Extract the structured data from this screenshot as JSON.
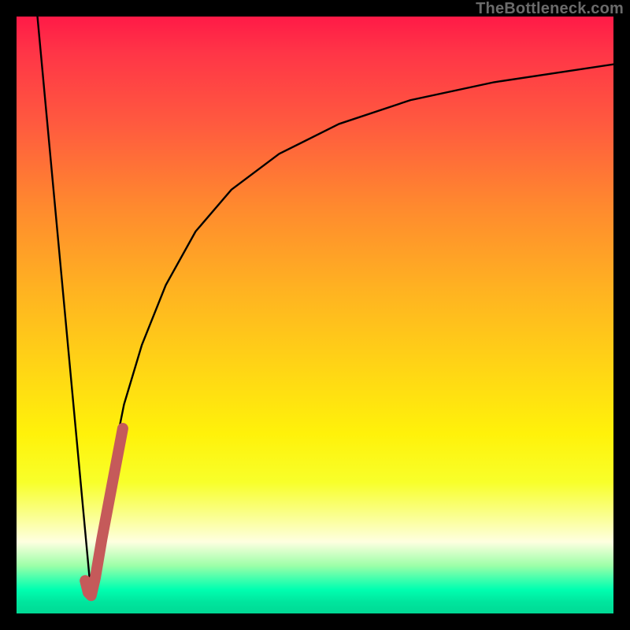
{
  "watermark": {
    "text": "TheBottleneck.com"
  },
  "colors": {
    "frame": "#000000",
    "curve_black": "#000000",
    "highlight_stroke": "#c55a5a"
  },
  "chart_data": {
    "type": "line",
    "title": "",
    "xlabel": "",
    "ylabel": "",
    "xlim": [
      0,
      100
    ],
    "ylim": [
      0,
      100
    ],
    "grid": false,
    "legend": false,
    "series": [
      {
        "name": "left-descending",
        "x": [
          3.5,
          12.5
        ],
        "y": [
          100,
          3
        ]
      },
      {
        "name": "right-rising",
        "x": [
          12.5,
          14,
          16,
          18,
          21,
          25,
          30,
          36,
          44,
          54,
          66,
          80,
          100
        ],
        "y": [
          3,
          14,
          25,
          35,
          45,
          55,
          64,
          71,
          77,
          82,
          86,
          89,
          92
        ]
      },
      {
        "name": "highlight-j",
        "x": [
          11.5,
          12.0,
          12.5,
          13.2,
          14.3,
          15.9,
          17.8
        ],
        "y": [
          5.5,
          3.5,
          3.0,
          6.0,
          12.5,
          21.0,
          31.0
        ]
      }
    ]
  }
}
